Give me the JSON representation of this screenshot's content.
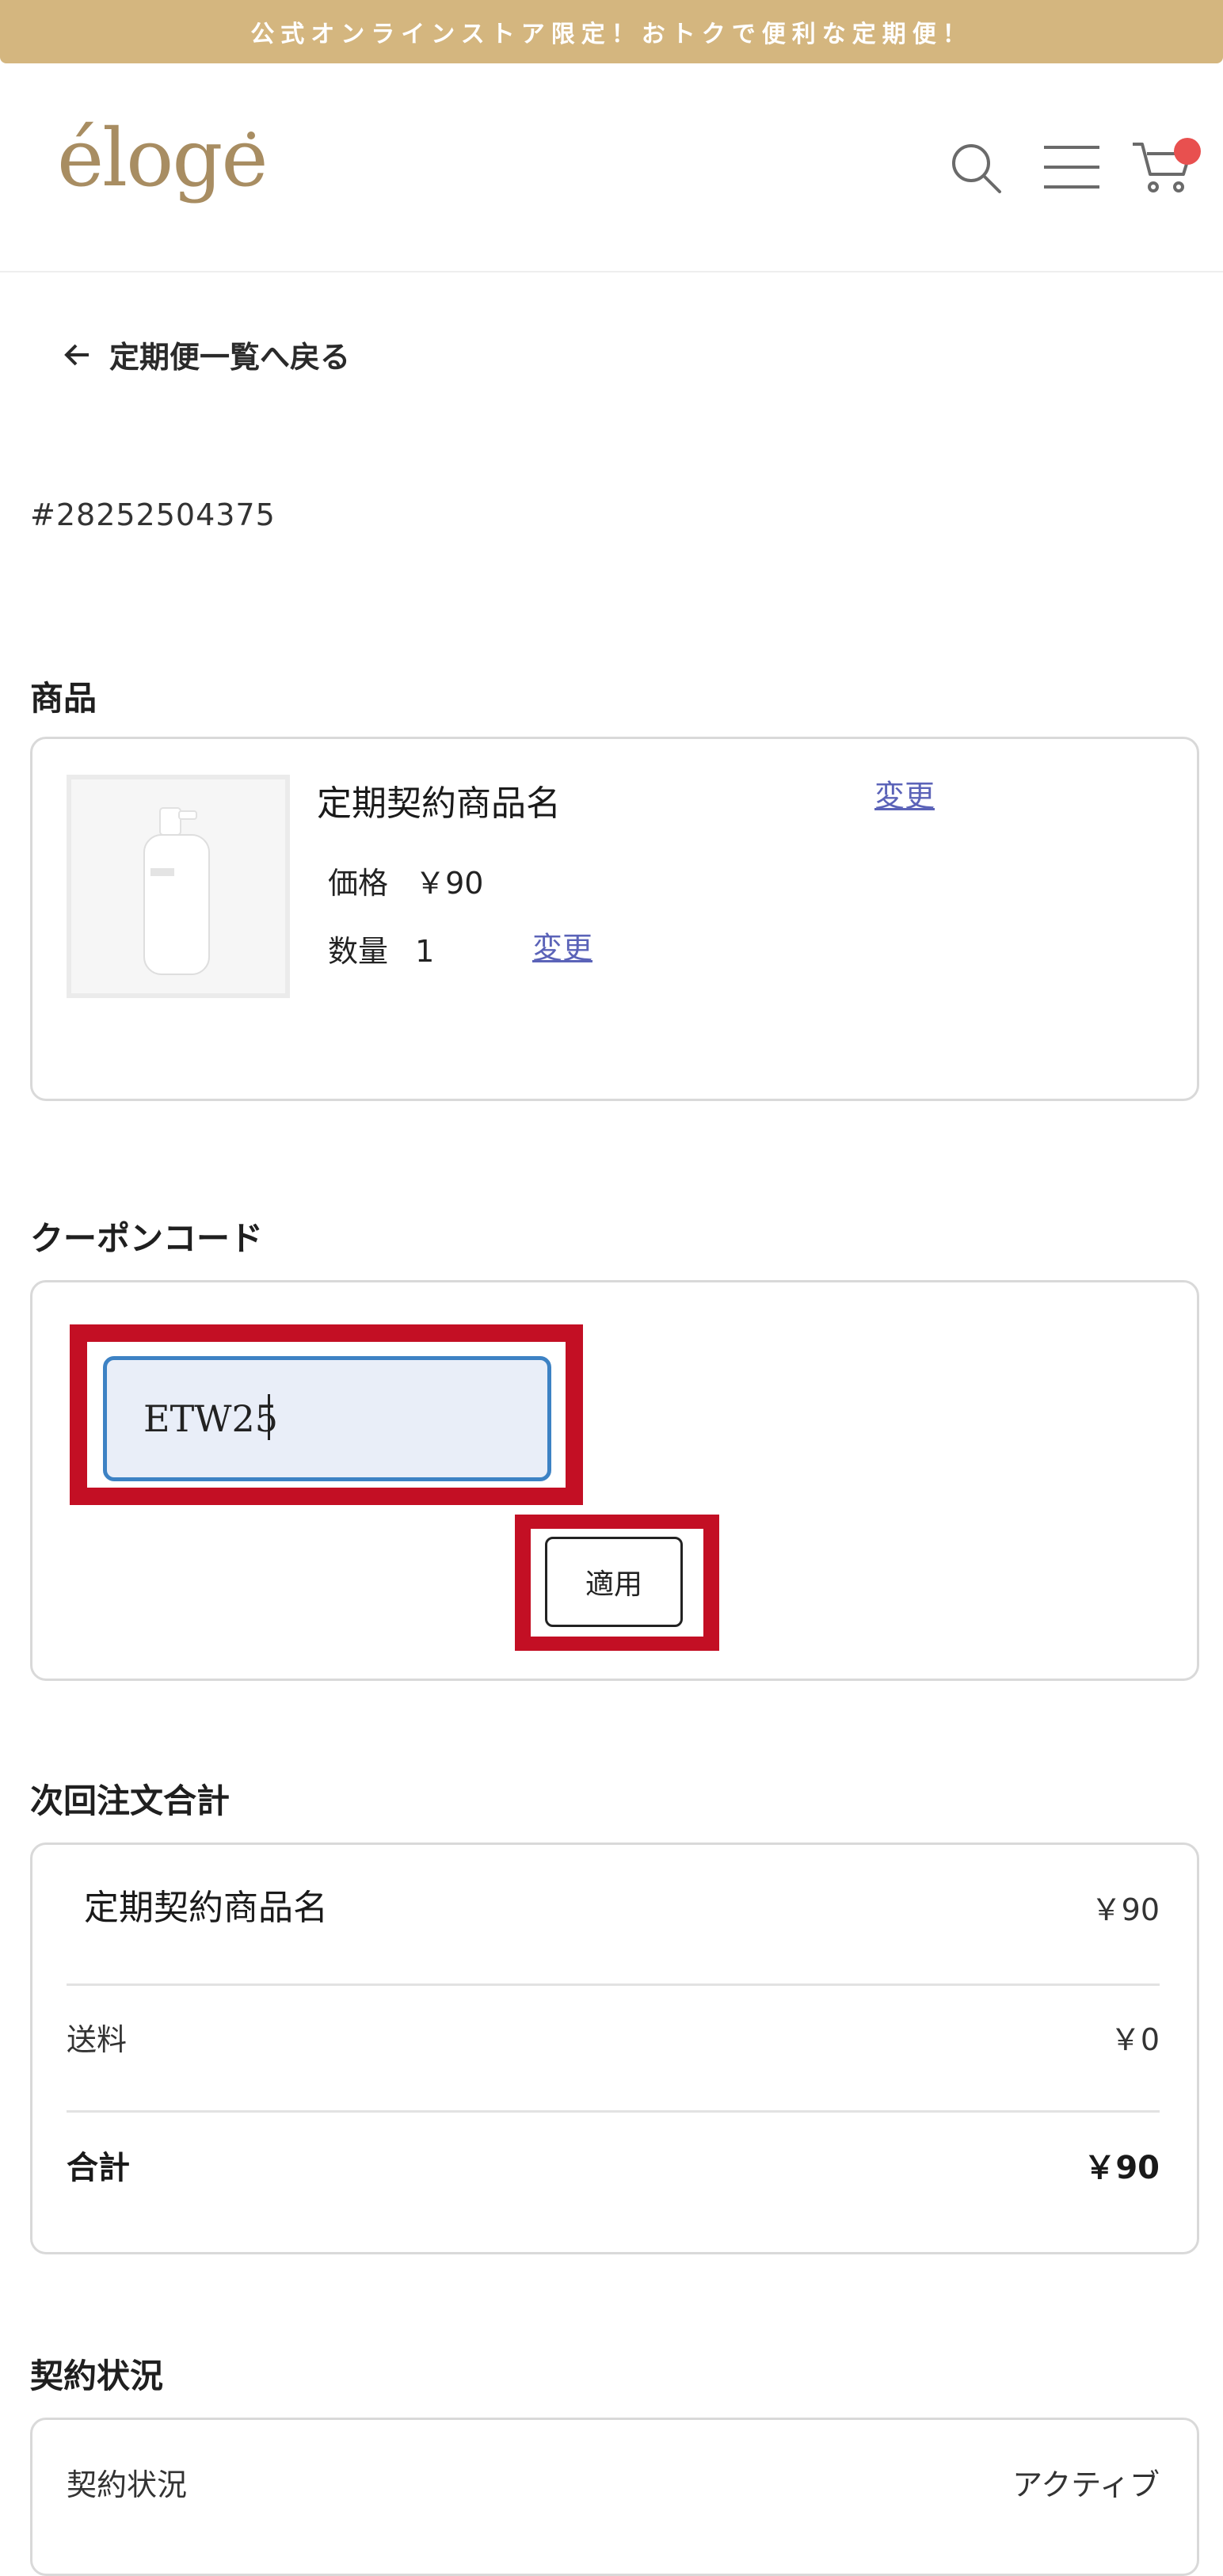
{
  "announcement": "公式オンラインストア限定！おトクで便利な定期便！",
  "header": {
    "logo_text": "éloge",
    "icons": [
      "search-icon",
      "menu-icon",
      "cart-icon"
    ],
    "accent_color": "#d4b67f",
    "badge_color": "#e8504f"
  },
  "back_link": "定期便一覧へ戻る",
  "order_id": "#28252504375",
  "products": {
    "title": "商品",
    "name": "定期契約商品名",
    "change_label": "変更",
    "price_label": "価格",
    "price": "￥90",
    "qty_label": "数量",
    "qty": "1",
    "qty_change_label": "変更"
  },
  "coupon": {
    "title": "クーポンコード",
    "value": "ETW25",
    "apply_label": "適用",
    "highlight_color": "#c30f24"
  },
  "summary": {
    "title": "次回注文合計",
    "item_name": "定期契約商品名",
    "item_price": "￥90",
    "shipping_label": "送料",
    "shipping_value": "￥0",
    "total_label": "合計",
    "total_value": "￥90"
  },
  "contract": {
    "title": "契約状況",
    "label": "契約状況",
    "value": "アクティブ"
  }
}
